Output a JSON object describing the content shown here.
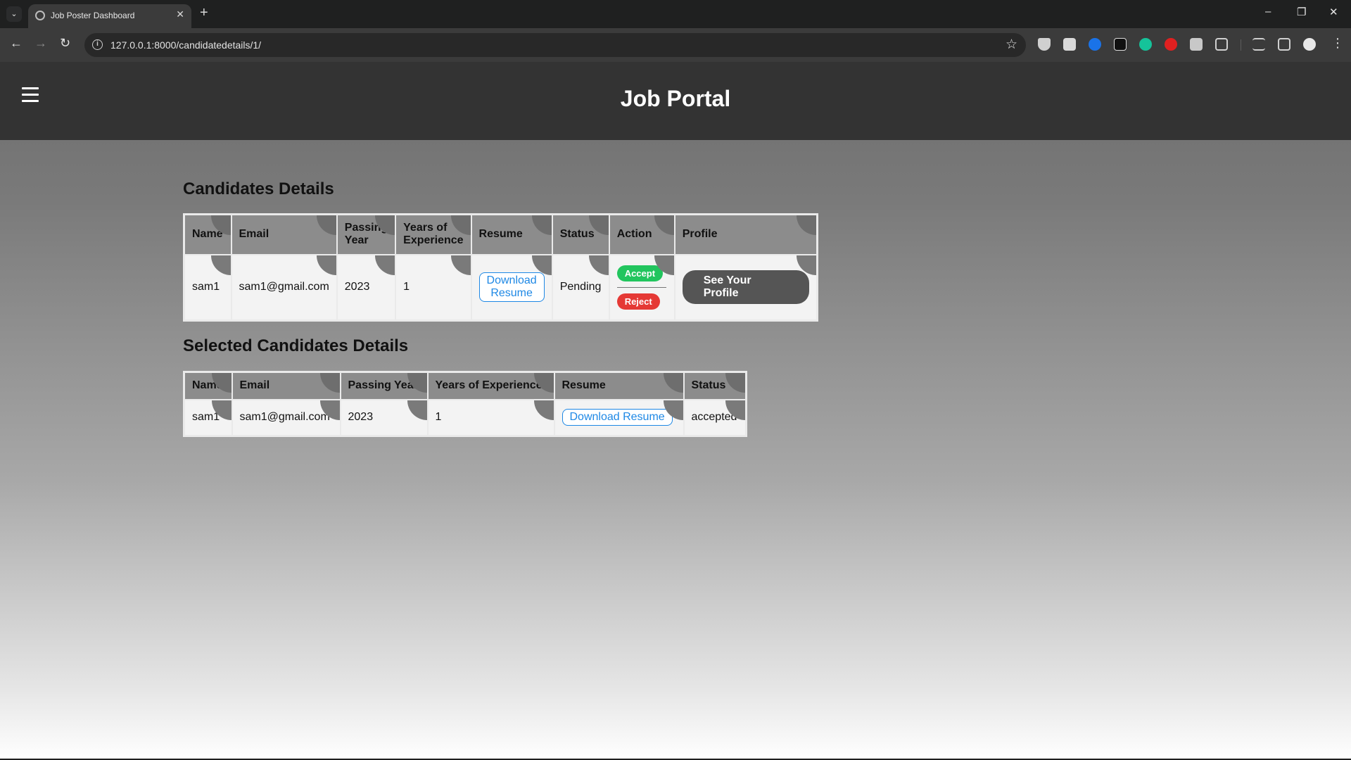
{
  "browser": {
    "tab_title": "Job Poster Dashboard",
    "url": "127.0.0.1:8000/candidatedetails/1/"
  },
  "site": {
    "title": "Job Portal"
  },
  "candidates": {
    "title": "Candidates Details",
    "headers": {
      "name": "Name",
      "email": "Email",
      "passing_year_1": "Passing",
      "passing_year_2": "Year",
      "experience_1": "Years of",
      "experience_2": "Experience",
      "resume": "Resume",
      "status": "Status",
      "action": "Action",
      "profile": "Profile"
    },
    "rows": [
      {
        "name": "sam1",
        "email": "sam1@gmail.com",
        "passing_year": "2023",
        "experience": "1",
        "resume_btn_1": "Download",
        "resume_btn_2": "Resume",
        "status": "Pending",
        "accept": "Accept",
        "reject": "Reject",
        "profile_btn": "See Your Profile"
      }
    ]
  },
  "selected": {
    "title": "Selected Candidates Details",
    "headers": {
      "name": "Name",
      "email": "Email",
      "passing_year": "Passing Year",
      "experience": "Years of Experience",
      "resume": "Resume",
      "status": "Status"
    },
    "rows": [
      {
        "name": "sam1",
        "email": "sam1@gmail.com",
        "passing_year": "2023",
        "experience": "1",
        "resume_btn": "Download Resume",
        "status": "accepted"
      }
    ]
  }
}
